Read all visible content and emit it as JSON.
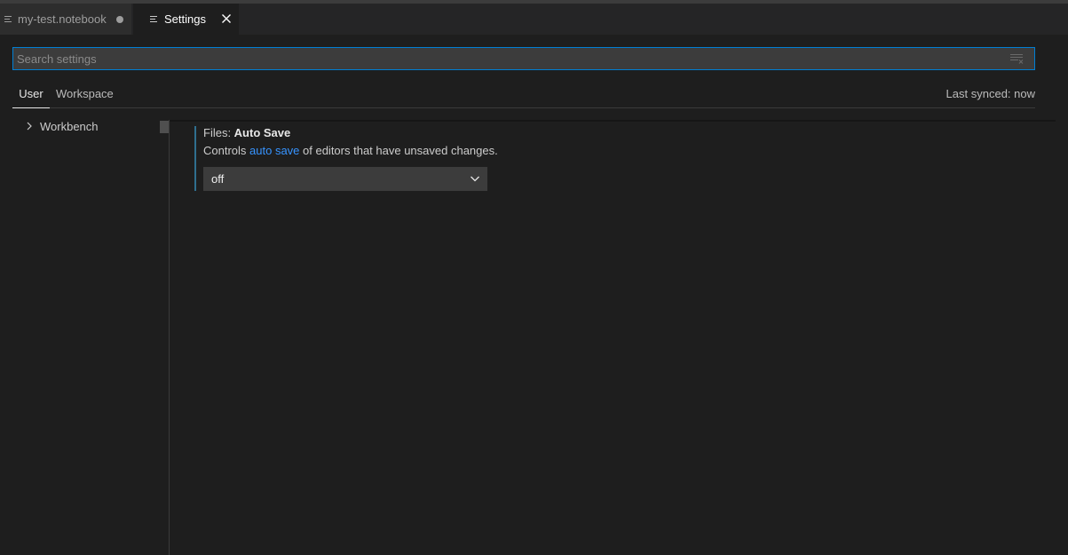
{
  "tabs": [
    {
      "label": "my-test.notebook",
      "active": false,
      "dirty": true,
      "icon": "notebook-icon"
    },
    {
      "label": "Settings",
      "active": true,
      "dirty": false,
      "icon": "settings-file-icon"
    }
  ],
  "search": {
    "placeholder": "Search settings",
    "value": ""
  },
  "scope": {
    "user_label": "User",
    "workspace_label": "Workspace",
    "active": "User"
  },
  "sync": {
    "status": "Last synced: now"
  },
  "toc": {
    "items": [
      {
        "label": "Workbench",
        "expanded": false
      }
    ]
  },
  "setting": {
    "category": "Files: ",
    "name": "Auto Save",
    "desc_before": "Controls ",
    "desc_link": "auto save",
    "desc_after": " of editors that have unsaved changes.",
    "value": "off"
  },
  "colors": {
    "background": "#1e1e1e",
    "tab_bar": "#252526",
    "focus_border": "#007fd4",
    "link": "#3794ff",
    "modified_indicator": "#2f6f8f"
  }
}
